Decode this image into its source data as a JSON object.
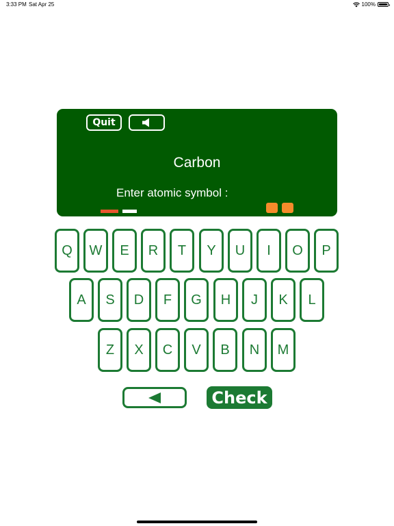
{
  "status_bar": {
    "time": "3:33 PM",
    "date": "Sat Apr 25",
    "battery": "100%",
    "battery_level": 1.0
  },
  "board": {
    "quit_label": "Quit",
    "sound_icon": "speaker-icon",
    "element_name": "Carbon",
    "prompt": "Enter atomic symbol :"
  },
  "keyboard": {
    "row1": [
      "Q",
      "W",
      "E",
      "R",
      "T",
      "Y",
      "U",
      "I",
      "O",
      "P"
    ],
    "row2": [
      "A",
      "S",
      "D",
      "F",
      "G",
      "H",
      "J",
      "K",
      "L"
    ],
    "row3": [
      "Z",
      "X",
      "C",
      "V",
      "B",
      "N",
      "M"
    ]
  },
  "actions": {
    "backspace_icon": "left-triangle-icon",
    "check_label": "Check"
  },
  "colors": {
    "board": "#015a01",
    "key_accent": "#1c7a33",
    "progress_red": "#e8562f",
    "orange": "#f58b2b"
  }
}
